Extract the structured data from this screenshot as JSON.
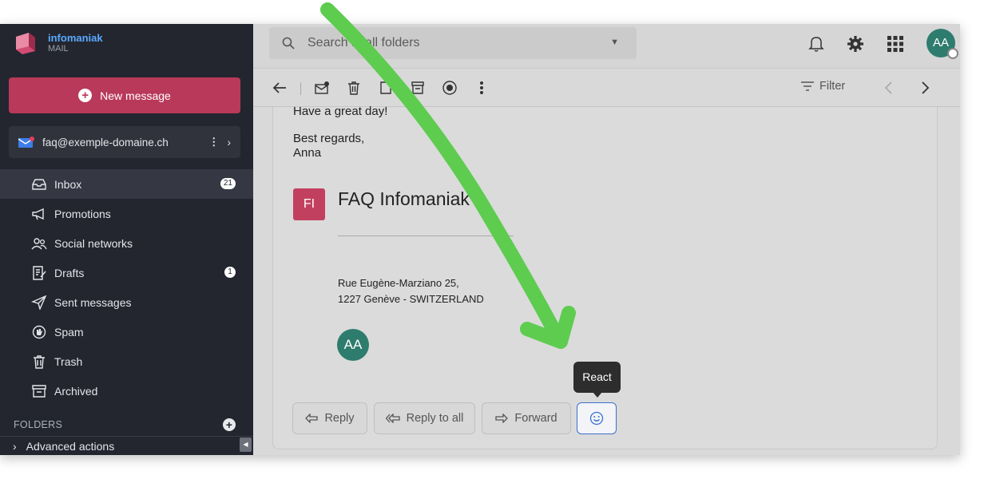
{
  "brand": {
    "name": "infomaniak",
    "product": "MAIL"
  },
  "sidebar": {
    "new_message": "New message",
    "account": "faq@exemple-domaine.ch",
    "items": [
      {
        "label": "Inbox",
        "icon": "inbox-icon",
        "badge": "21"
      },
      {
        "label": "Promotions",
        "icon": "megaphone-icon",
        "badge": ""
      },
      {
        "label": "Social networks",
        "icon": "people-icon",
        "badge": ""
      },
      {
        "label": "Drafts",
        "icon": "draft-icon",
        "badge": "1"
      },
      {
        "label": "Sent messages",
        "icon": "send-icon",
        "badge": ""
      },
      {
        "label": "Spam",
        "icon": "spam-icon",
        "badge": ""
      },
      {
        "label": "Trash",
        "icon": "trash-icon",
        "badge": ""
      },
      {
        "label": "Archived",
        "icon": "archive-icon",
        "badge": ""
      }
    ],
    "folders_label": "FOLDERS",
    "advanced": "Advanced actions"
  },
  "header": {
    "search_placeholder": "Search in all folders",
    "user_initials": "AA"
  },
  "toolbar": {
    "filter": "Filter"
  },
  "message": {
    "line1": "Have a great day!",
    "line2": "Best regards,",
    "line3": "Anna",
    "sig_initials": "FI",
    "sig_name": "FAQ Infomaniak",
    "addr1": "Rue Eugène-Marziano 25,",
    "addr2": "1227 Genève - SWITZERLAND",
    "avatar_initials": "AA"
  },
  "actions": {
    "reply": "Reply",
    "reply_all": "Reply to all",
    "forward": "Forward",
    "react_tooltip": "React"
  },
  "colors": {
    "sidebar_bg": "#23262f",
    "accent": "#b9395a",
    "brand_blue": "#5aa9ff",
    "avatar_green": "#2e7c6e",
    "arrow_green": "#5dcc4f"
  }
}
